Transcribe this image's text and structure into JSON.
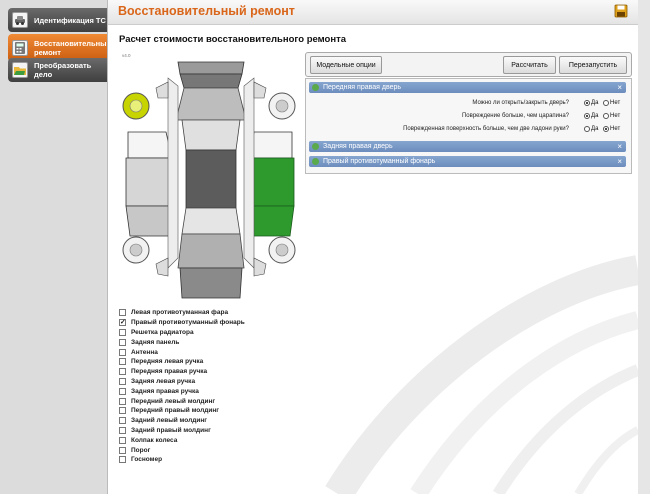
{
  "sidebar": {
    "items": [
      {
        "label": "Идентификация ТС",
        "icon": "car-icon"
      },
      {
        "label": "Восстановительный ремонт",
        "icon": "calculator-icon"
      },
      {
        "label": "Преобразовать дело",
        "icon": "folder-icon"
      }
    ]
  },
  "header": {
    "title": "Восстановительный ремонт",
    "save_icon": "save-icon"
  },
  "content": {
    "subtitle": "Расчет стоимости восстановительного ремонта",
    "version": "v4.0"
  },
  "toolbar": {
    "model_options": "Модельные опции",
    "calculate": "Рассчитать",
    "restart": "Перезапустить"
  },
  "panel": {
    "sections": [
      {
        "title": "Передняя правая дверь",
        "expanded": true,
        "questions": [
          {
            "text": "Можно ли открыть/закрыть дверь?",
            "selected": "Да"
          },
          {
            "text": "Повреждение больше, чем царапина?",
            "selected": "Да"
          },
          {
            "text": "Поврежденная поверхность больше, чем две ладони руки?",
            "selected": "Нет"
          }
        ]
      },
      {
        "title": "Задняя правая дверь",
        "expanded": false
      },
      {
        "title": "Правый противотуманный фонарь",
        "expanded": false
      }
    ],
    "yes": "Да",
    "no": "Нет",
    "close": "×"
  },
  "parts": [
    {
      "label": "Левая противотуманная фара",
      "checked": false
    },
    {
      "label": "Правый противотуманный фонарь",
      "checked": true
    },
    {
      "label": "Решетка радиатора",
      "checked": false
    },
    {
      "label": "Задняя панель",
      "checked": false
    },
    {
      "label": "Антенна",
      "checked": false
    },
    {
      "label": "Передняя левая ручка",
      "checked": false
    },
    {
      "label": "Передняя правая ручка",
      "checked": false
    },
    {
      "label": "Задняя левая ручка",
      "checked": false
    },
    {
      "label": "Задняя правая ручка",
      "checked": false
    },
    {
      "label": "Передний левый молдинг",
      "checked": false
    },
    {
      "label": "Передний правый молдинг",
      "checked": false
    },
    {
      "label": "Задний левый молдинг",
      "checked": false
    },
    {
      "label": "Задний правый молдинг",
      "checked": false
    },
    {
      "label": "Колпак колеса",
      "checked": false
    },
    {
      "label": "Порог",
      "checked": false
    },
    {
      "label": "Госномер",
      "checked": false
    }
  ],
  "colors": {
    "accent": "#d9661a",
    "section": "#7395c4",
    "damaged": "#2e9a2e",
    "selected_wheel": "#c8d400"
  }
}
